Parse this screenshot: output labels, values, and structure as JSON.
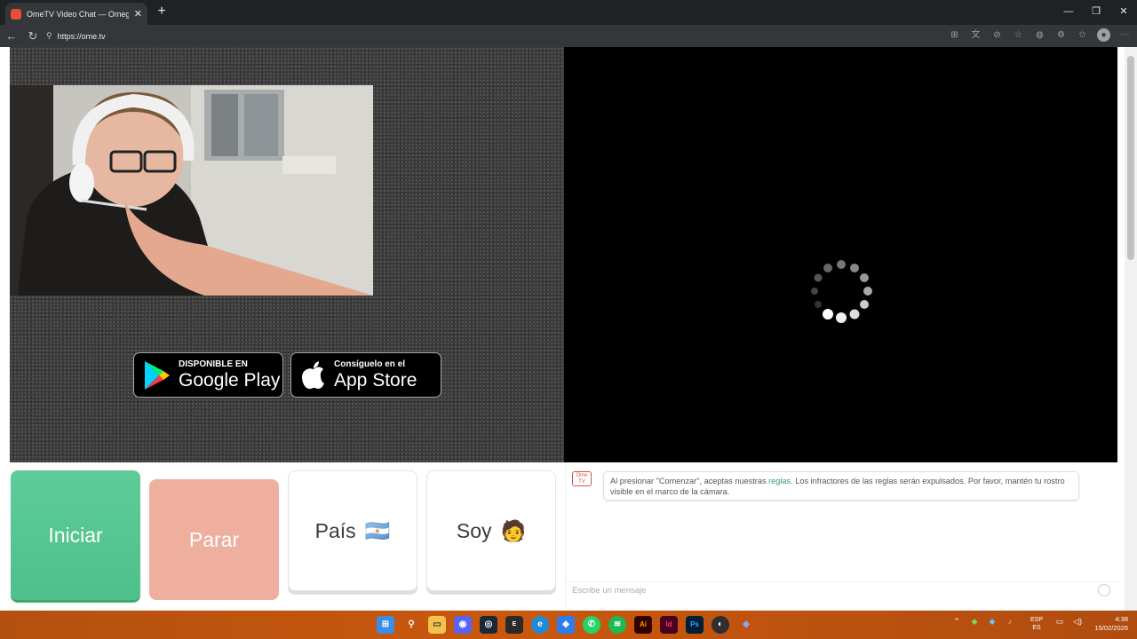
{
  "browser": {
    "tab_title": "OmeTV Video Chat — Omegle Rai",
    "tab_close": "✕",
    "new_tab": "+",
    "url": "https://ome.tv",
    "window_controls": {
      "minimize": "—",
      "maximize": "❐",
      "close": "✕"
    },
    "nav": {
      "back": "←",
      "reload": "↻"
    }
  },
  "badges": {
    "google_play": {
      "small": "DISPONIBLE EN",
      "big": "Google Play"
    },
    "app_store": {
      "small": "Consíguelo en el",
      "big": "App Store"
    }
  },
  "controls": {
    "start_label": "Iniciar",
    "stop_label": "Parar",
    "country_label": "País",
    "country_flag": "🇦🇷",
    "gender_label": "Soy",
    "gender_emoji": "🧑"
  },
  "chat": {
    "logo_text": "Ome TV",
    "message_before": "Al presionar \"Comenzar\", aceptas nuestras ",
    "message_link": "reglas",
    "message_after": ". Los infractores de las reglas serán expulsados. Por favor, mantén tu rostro visible en el marco de la cámara.",
    "input_placeholder": "Escribe un mensaje"
  },
  "taskbar": {
    "lang_line1": "ESP",
    "lang_line2": "ES",
    "time": "4:38",
    "date": "15/02/2026",
    "apps": [
      "windows-icon",
      "search-icon",
      "file-explorer-icon",
      "discord-icon",
      "steam-icon",
      "epic-games-icon",
      "edge-icon",
      "app-icon",
      "whatsapp-icon",
      "spotify-icon",
      "illustrator-icon",
      "indesign-icon",
      "photoshop-icon",
      "obs-icon",
      "app-icon-2"
    ]
  },
  "colors": {
    "start": "#5ecc98",
    "stop": "#eeaf9f",
    "taskbar": "#c9580e",
    "link": "#3c9b6b"
  }
}
